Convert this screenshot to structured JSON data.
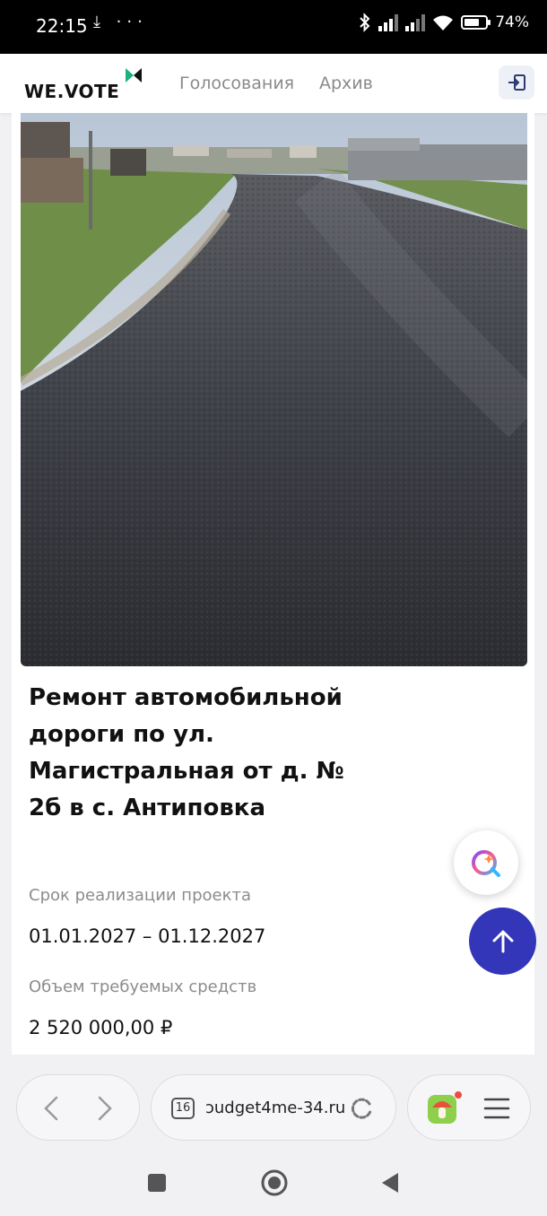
{
  "status_bar": {
    "time": "22:15",
    "left_icons": "⤓ ···",
    "battery_text": "74%",
    "battery_level": 0.74
  },
  "header": {
    "logo_text": "WE.VOTE",
    "nav": [
      "Голосования",
      "Архив"
    ],
    "login_icon": "login-icon"
  },
  "project": {
    "title": "Ремонт автомобильной дороги по ул. Магистральная от д. № 2б в с. Антиповка",
    "term_label": "Срок реализации проекта",
    "term_value": "01.01.2027 – 01.12.2027",
    "funds_label": "Объем требуемых средств",
    "funds_value": "2 520 000,00 ₽"
  },
  "fab": {
    "assistant_icon": "assistant-icon",
    "scroll_top_icon": "arrow-up-icon"
  },
  "browser": {
    "back_icon": "chevron-left-icon",
    "forward_icon": "chevron-right-icon",
    "tab_count": "16",
    "url": "ɔudget4me-34.ru",
    "reload_icon": "reload-icon",
    "extension_icon": "mushroom-icon",
    "menu_icon": "hamburger-icon"
  },
  "colors": {
    "accent": "#3336b8",
    "logo_green": "#19b37a",
    "nav_grey": "#8a8a8a"
  }
}
